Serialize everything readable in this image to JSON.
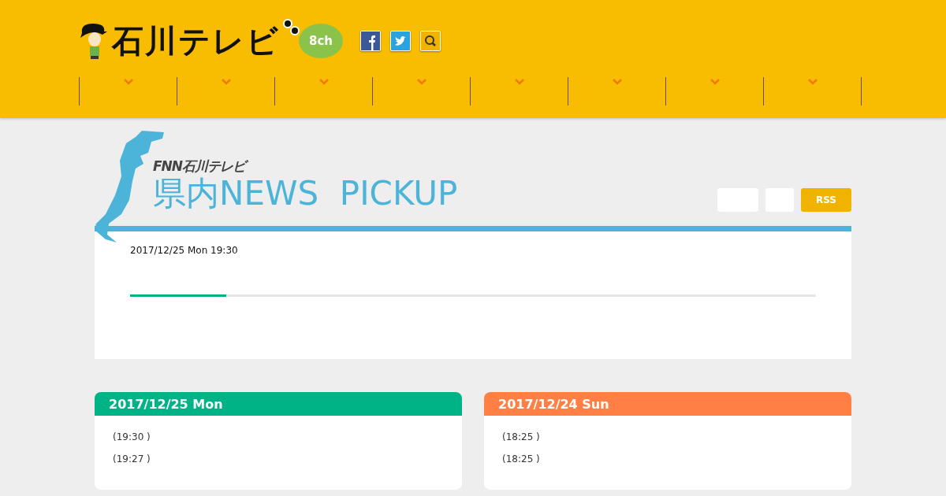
{
  "header": {
    "logo": {
      "title": "石川テレビ",
      "channel": "8ch"
    },
    "nav": [
      {
        "kind": "dropdown"
      },
      {
        "kind": "dropdown"
      },
      {
        "kind": "dropdown"
      },
      {
        "kind": "dropdown"
      },
      {
        "kind": "dropdown"
      },
      {
        "kind": "dropdown"
      },
      {
        "kind": "dropdown"
      },
      {
        "kind": "dropdown"
      }
    ]
  },
  "pickup": {
    "brand": "FNN石川テレビ",
    "title": "県内NEWS  PICKUP",
    "buttons": [
      {
        "kind": "blank"
      },
      {
        "kind": "blank"
      },
      {
        "label": "RSS",
        "kind": "rss"
      }
    ],
    "timestamp": "2017/12/25 Mon 19:30",
    "progress": {
      "level": 0.14
    }
  },
  "days": [
    {
      "date": "2017/12/25 Mon",
      "color": "#00b386",
      "items": [
        "(19:30 )",
        "(19:27 )"
      ]
    },
    {
      "date": "2017/12/24 Sun",
      "color": "#ff7f45",
      "items": [
        "(18:25 )",
        "(18:25 )"
      ]
    }
  ]
}
